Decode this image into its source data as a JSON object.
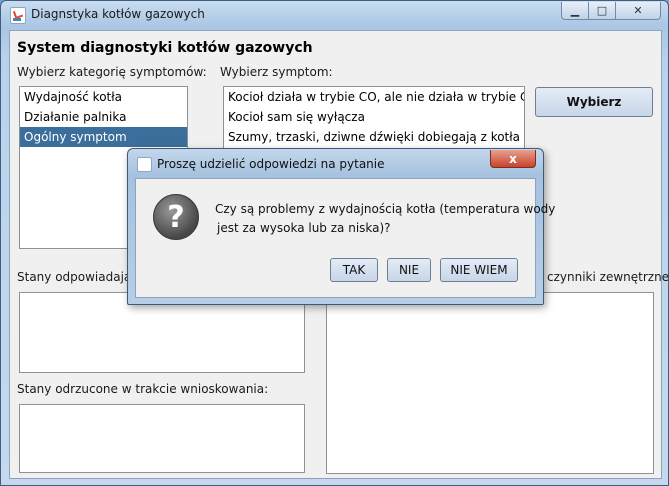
{
  "window": {
    "title": "Diagnstyka kotłów gazowych"
  },
  "main": {
    "heading": "System diagnostyki kotłów gazowych",
    "category_label": "Wybierz kategorię symptomów:",
    "categories": [
      "Wydajność kotła",
      "Działanie palnika",
      "Ogólny symptom"
    ],
    "selected_category_index": 2,
    "symptom_label": "Wybierz symptom:",
    "symptoms": [
      "Kocioł działa w trybie CO, ale nie działa w trybie CWU",
      "Kocioł sam się wyłącza",
      "Szumy, trzaski, dziwne dźwięki dobiegają z kotła"
    ],
    "choose_button": "Wybierz",
    "matching_states_label": "Stany odpowiadające",
    "external_factors_label": "czynniki zewnętrzne:",
    "rejected_states_label": "Stany odrzucone w trakcie wnioskowania:"
  },
  "dialog": {
    "title": "Proszę udzielić odpowiedzi na pytanie",
    "close": "x",
    "question_line1": "Czy są problemy z wydajnością kotła (temperatura wody",
    "question_line2": "jest za wysoka lub za niska)?",
    "icon_glyph": "?",
    "yes_button": "TAK",
    "no_button": "NIE",
    "dont_know_button": "NIE WIEM"
  },
  "colors": {
    "selection": "#3b6e9a",
    "window_frame": "#a9c6e4",
    "close_button": "#c8442c"
  }
}
